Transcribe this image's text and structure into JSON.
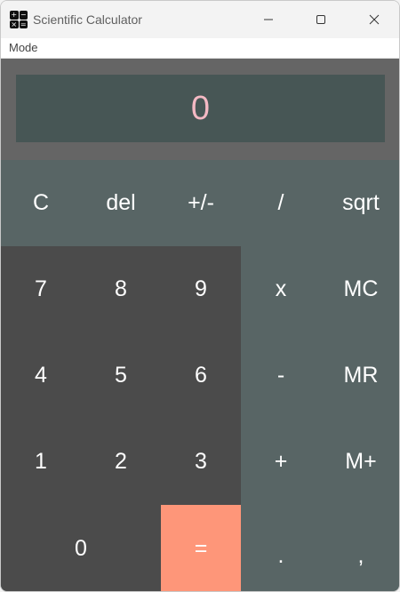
{
  "window": {
    "title": "Scientific Calculator",
    "icon_glyphs": [
      "+",
      "−",
      "×",
      "="
    ]
  },
  "menu": {
    "items": [
      "Mode"
    ]
  },
  "display": {
    "value": "0",
    "text_color": "#f4b9c4",
    "background": "#475655"
  },
  "keys": {
    "clear": "C",
    "delete": "del",
    "negate": "+/-",
    "divide": "/",
    "sqrt": "sqrt",
    "seven": "7",
    "eight": "8",
    "nine": "9",
    "multiply": "x",
    "mem_clear": "MC",
    "four": "4",
    "five": "5",
    "six": "6",
    "subtract": "-",
    "mem_recall": "MR",
    "one": "1",
    "two": "2",
    "three": "3",
    "add": "+",
    "mem_add": "M+",
    "zero": "0",
    "equals": "=",
    "decimal": ".",
    "comma": ","
  },
  "colors": {
    "number_key": "#4b4b4b",
    "function_key": "#586565",
    "equals_key": "#fe9679",
    "display_frame": "#656565"
  }
}
